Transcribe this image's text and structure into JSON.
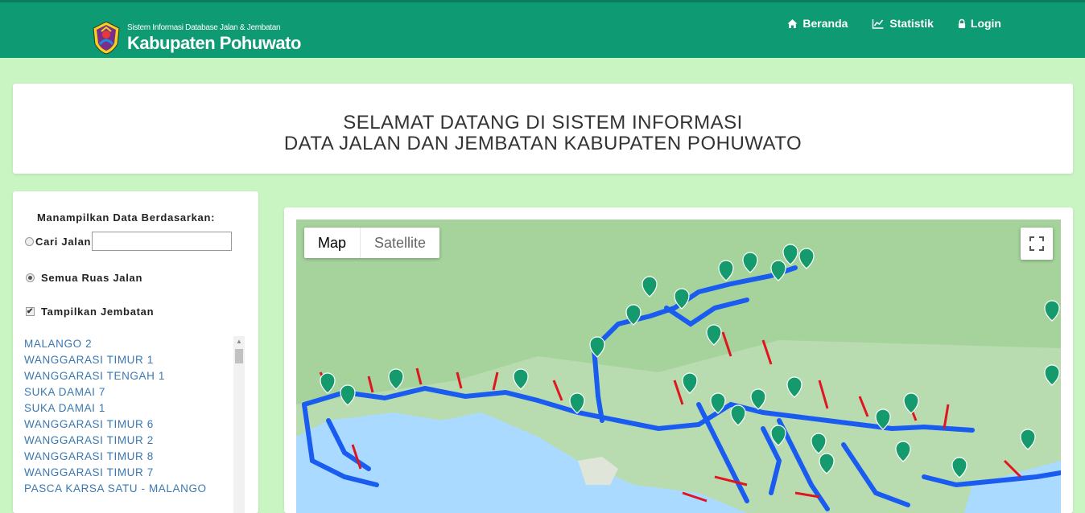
{
  "header": {
    "subtitle": "Sistem Informasi Database Jalan & Jembatan",
    "title": "Kabupaten Pohuwato",
    "nav": [
      {
        "label": "Beranda",
        "icon": "home-icon"
      },
      {
        "label": "Statistik",
        "icon": "line-chart-icon"
      },
      {
        "label": "Login",
        "icon": "lock-icon"
      }
    ]
  },
  "welcome": {
    "line1": "SELAMAT DATANG DI SISTEM INFORMASI",
    "line2": "DATA JALAN DAN JEMBATAN KABUPATEN POHUWATO"
  },
  "sidebar": {
    "heading": "Manampilkan Data Berdasarkan:",
    "search_label": "Cari Jalan",
    "search_value": "",
    "all_roads_label": "Semua Ruas Jalan",
    "show_bridges_label": "Tampilkan Jembatan",
    "roads": [
      "MALANGO 2",
      "WANGGARASI TIMUR 1",
      "WANGGARASI TENGAH 1",
      "SUKA DAMAI 7",
      "SUKA DAMAI 1",
      "WANGGARASI TIMUR 6",
      "WANGGARASI TIMUR 2",
      "WANGGARASI TIMUR 8",
      "WANGGARASI TIMUR 7",
      "PASCA KARSA SATU - MALANGO"
    ]
  },
  "map": {
    "type_map": "Map",
    "type_satellite": "Satellite"
  },
  "colors": {
    "header": "#0e9a72",
    "page_bg": "#c8f5c2",
    "road_blue": "#1a5cf0",
    "road_red": "#e0151f",
    "marker": "#159a6e",
    "sea": "#aadaff",
    "land": "#a8d5a0"
  }
}
